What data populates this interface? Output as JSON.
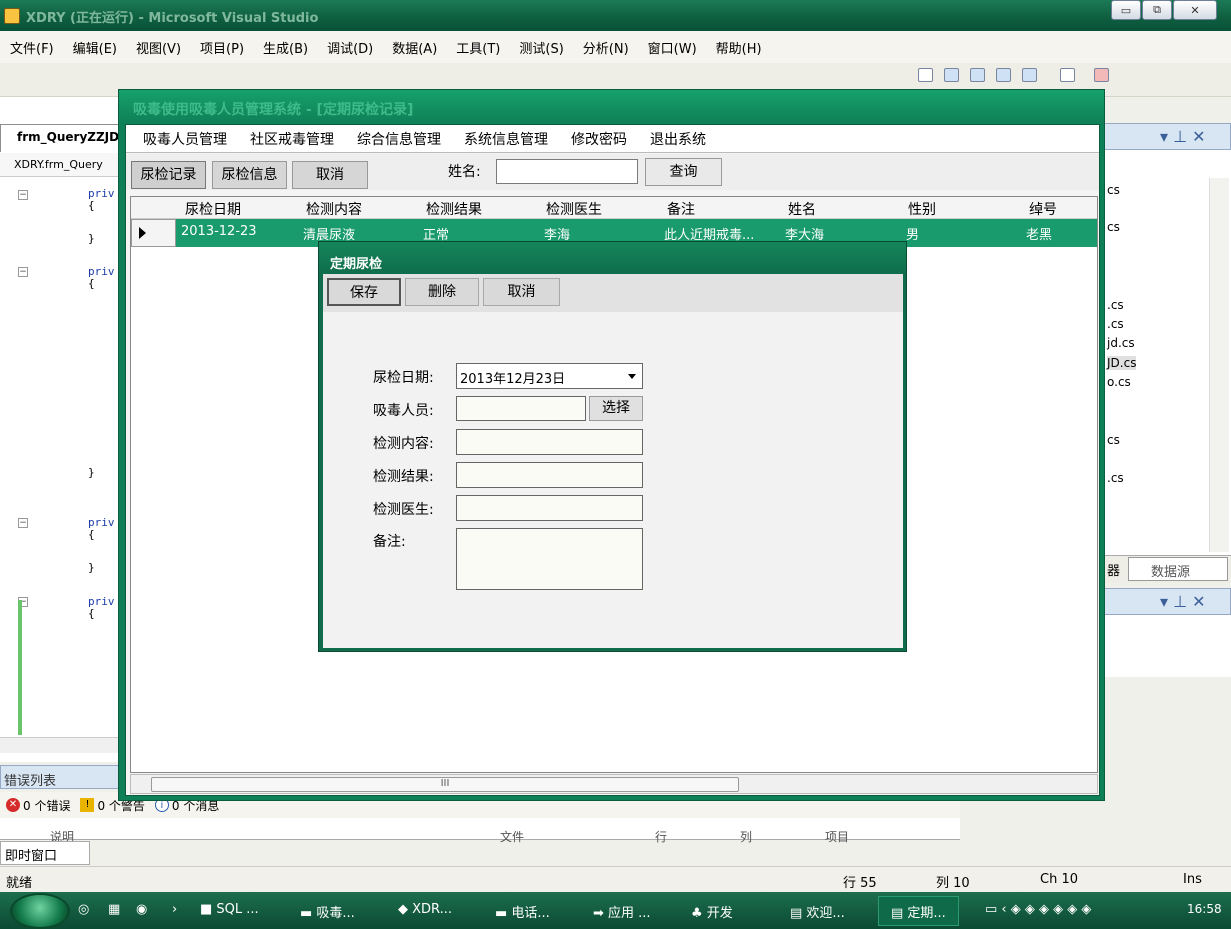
{
  "vs": {
    "title": "XDRY (正在运行) - Microsoft Visual Studio",
    "menu": [
      "文件(F)",
      "编辑(E)",
      "视图(V)",
      "项目(P)",
      "生成(B)",
      "调试(D)",
      "数据(A)",
      "工具(T)",
      "测试(S)",
      "分析(N)",
      "窗口(W)",
      "帮助(H)"
    ],
    "doc_tab": "frm_QueryZZJD",
    "doc_combo": "XDRY.frm_Query",
    "code_lines": [
      "priv",
      "{",
      "}",
      "priv",
      "{",
      "}",
      "priv",
      "{",
      "}",
      "priv",
      "{"
    ],
    "errors_title": "错误列表",
    "errors_count": "0 个错误",
    "warnings_count": "0 个警告",
    "messages_count": "0 个消息",
    "error_cols": [
      "说明",
      "文件",
      "行",
      "列",
      "项目"
    ],
    "immediate": "即时窗口",
    "status": {
      "ready": "就绪",
      "line": "行 55",
      "col": "列 10",
      "ch": "Ch 10",
      "ins": "Ins"
    },
    "right_files": [
      "cs",
      "cs",
      ".cs",
      ".cs",
      "jd.cs",
      "JD.cs",
      "o.cs",
      "cs",
      ".cs"
    ],
    "right_tab_a": "器",
    "right_tab_b": "数据源",
    "pane_pin": "▾ ⊥ ✕"
  },
  "app": {
    "title": "吸毒使用吸毒人员管理系统 - [定期尿检记录]",
    "menu": [
      "吸毒人员管理",
      "社区戒毒管理",
      "综合信息管理",
      "系统信息管理",
      "修改密码",
      "退出系统"
    ],
    "toolbar": {
      "btn_records": "尿检记录",
      "btn_info": "尿检信息",
      "btn_cancel": "取消",
      "name_label": "姓名:",
      "name_value": "",
      "btn_query": "查询"
    },
    "grid": {
      "columns": [
        "尿检日期",
        "检测内容",
        "检测结果",
        "检测医生",
        "备注",
        "姓名",
        "性别",
        "绰号"
      ],
      "rows": [
        [
          "2013-12-23",
          "清晨尿液",
          "正常",
          "李海",
          "此人近期戒毒...",
          "李大海",
          "男",
          "老黑"
        ]
      ]
    },
    "scroll_thumb": "III"
  },
  "dialog": {
    "title": "定期尿检",
    "btn_save": "保存",
    "btn_delete": "删除",
    "btn_cancel": "取消",
    "labels": {
      "date": "尿检日期:",
      "person": "吸毒人员:",
      "content": "检测内容:",
      "result": "检测结果:",
      "doctor": "检测医生:",
      "note": "备注:"
    },
    "date_value": "2013年12月23日",
    "btn_select": "选择"
  },
  "taskbar": {
    "items": [
      "SQL ...",
      "吸毒...",
      "XDR...",
      "电话...",
      "应用 ...",
      "开发",
      "欢迎...",
      "定期..."
    ],
    "clock": "16:58"
  }
}
